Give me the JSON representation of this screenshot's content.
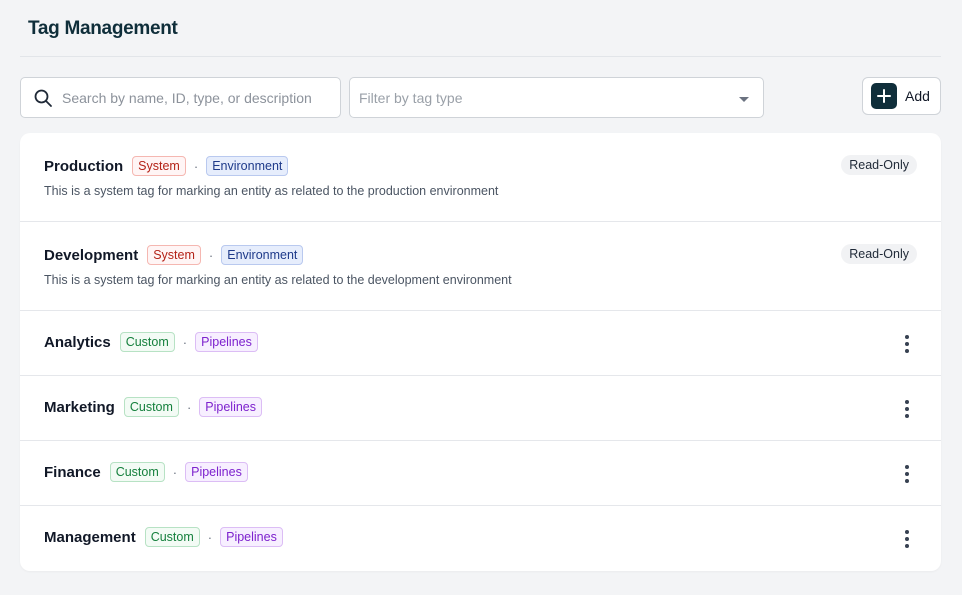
{
  "header": {
    "title": "Tag Management"
  },
  "toolbar": {
    "search_placeholder": "Search by name, ID, type, or description",
    "filter_placeholder": "Filter by tag type",
    "add_label": "Add"
  },
  "tags": [
    {
      "name": "Production",
      "kind": "System",
      "category": "Environment",
      "separator": "·",
      "description": "This is a system tag for marking an entity as related to the production environment",
      "status": "Read-Only"
    },
    {
      "name": "Development",
      "kind": "System",
      "category": "Environment",
      "separator": "·",
      "description": "This is a system tag for marking an entity as related to the development environment",
      "status": "Read-Only"
    },
    {
      "name": "Analytics",
      "kind": "Custom",
      "category": "Pipelines",
      "separator": "·"
    },
    {
      "name": "Marketing",
      "kind": "Custom",
      "category": "Pipelines",
      "separator": "·"
    },
    {
      "name": "Finance",
      "kind": "Custom",
      "category": "Pipelines",
      "separator": "·"
    },
    {
      "name": "Management",
      "kind": "Custom",
      "category": "Pipelines",
      "separator": "·"
    }
  ],
  "icons": {
    "search": "search-icon",
    "dropdown": "chevron-down-icon",
    "add": "plus-icon",
    "row_menu": "kebab-icon"
  },
  "colors": {
    "brand": "#0f2e3a",
    "system_badge": "#b42318",
    "custom_badge": "#15803d",
    "environment_badge": "#1e3a8a",
    "pipelines_badge": "#7e22ce"
  }
}
